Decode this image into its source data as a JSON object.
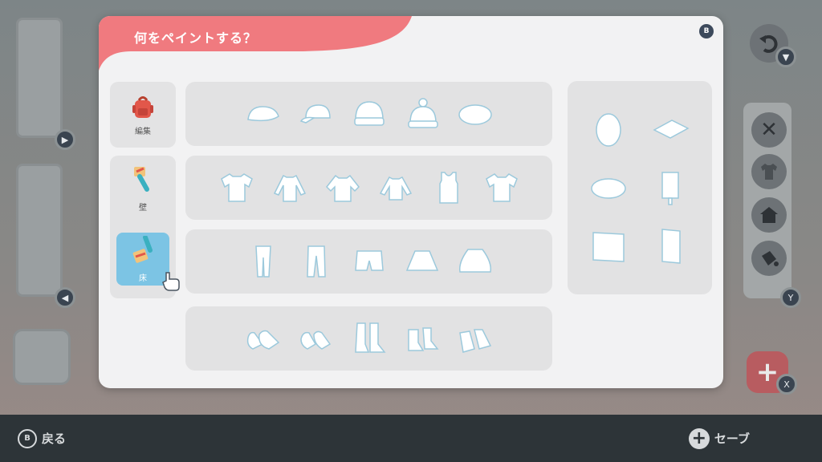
{
  "modal": {
    "title": "何をペイントする？",
    "close_button": "B"
  },
  "categories": [
    {
      "label": "編集",
      "icon": "backpack-icon",
      "selected": false
    },
    {
      "label": "壁",
      "icon": "paint-roller-icon",
      "selected": false
    },
    {
      "label": "床",
      "icon": "paint-roller-icon",
      "selected": true
    }
  ],
  "rows": {
    "hats": [
      "cap-icon",
      "baseball-cap-icon",
      "beanie-icon",
      "knit-hat-icon",
      "beret-icon"
    ],
    "tops": [
      "t-shirt-icon",
      "long-sleeve-icon",
      "sweater-icon",
      "jacket-icon",
      "tank-top-icon",
      "polo-shirt-icon"
    ],
    "bottoms": [
      "pants-icon",
      "trousers-icon",
      "shorts-icon",
      "skirt-icon",
      "long-skirt-icon"
    ],
    "shoes": [
      "sneakers-icon",
      "loafers-icon",
      "boots-icon",
      "ankle-boots-icon",
      "slip-ons-icon"
    ]
  },
  "side_items": [
    "egg-icon",
    "floor-tile-icon",
    "rug-oval-icon",
    "signboard-icon",
    "canvas-square-icon",
    "canvas-tall-icon"
  ],
  "background": {
    "slot_buttons": [
      "▶",
      "◀"
    ],
    "right_panel": [
      "close-icon",
      "shirt-icon",
      "house-icon",
      "paint-bucket-icon"
    ],
    "y_button": "Y",
    "x_button": "X",
    "undo_button": "▼"
  },
  "bottom_bar": {
    "back_key": "B",
    "back_label": "戻る",
    "save_label": "セーブ"
  },
  "colors": {
    "accent": "#f07a7f",
    "selected": "#7cc4e4",
    "modal_bg": "#f2f2f3"
  }
}
